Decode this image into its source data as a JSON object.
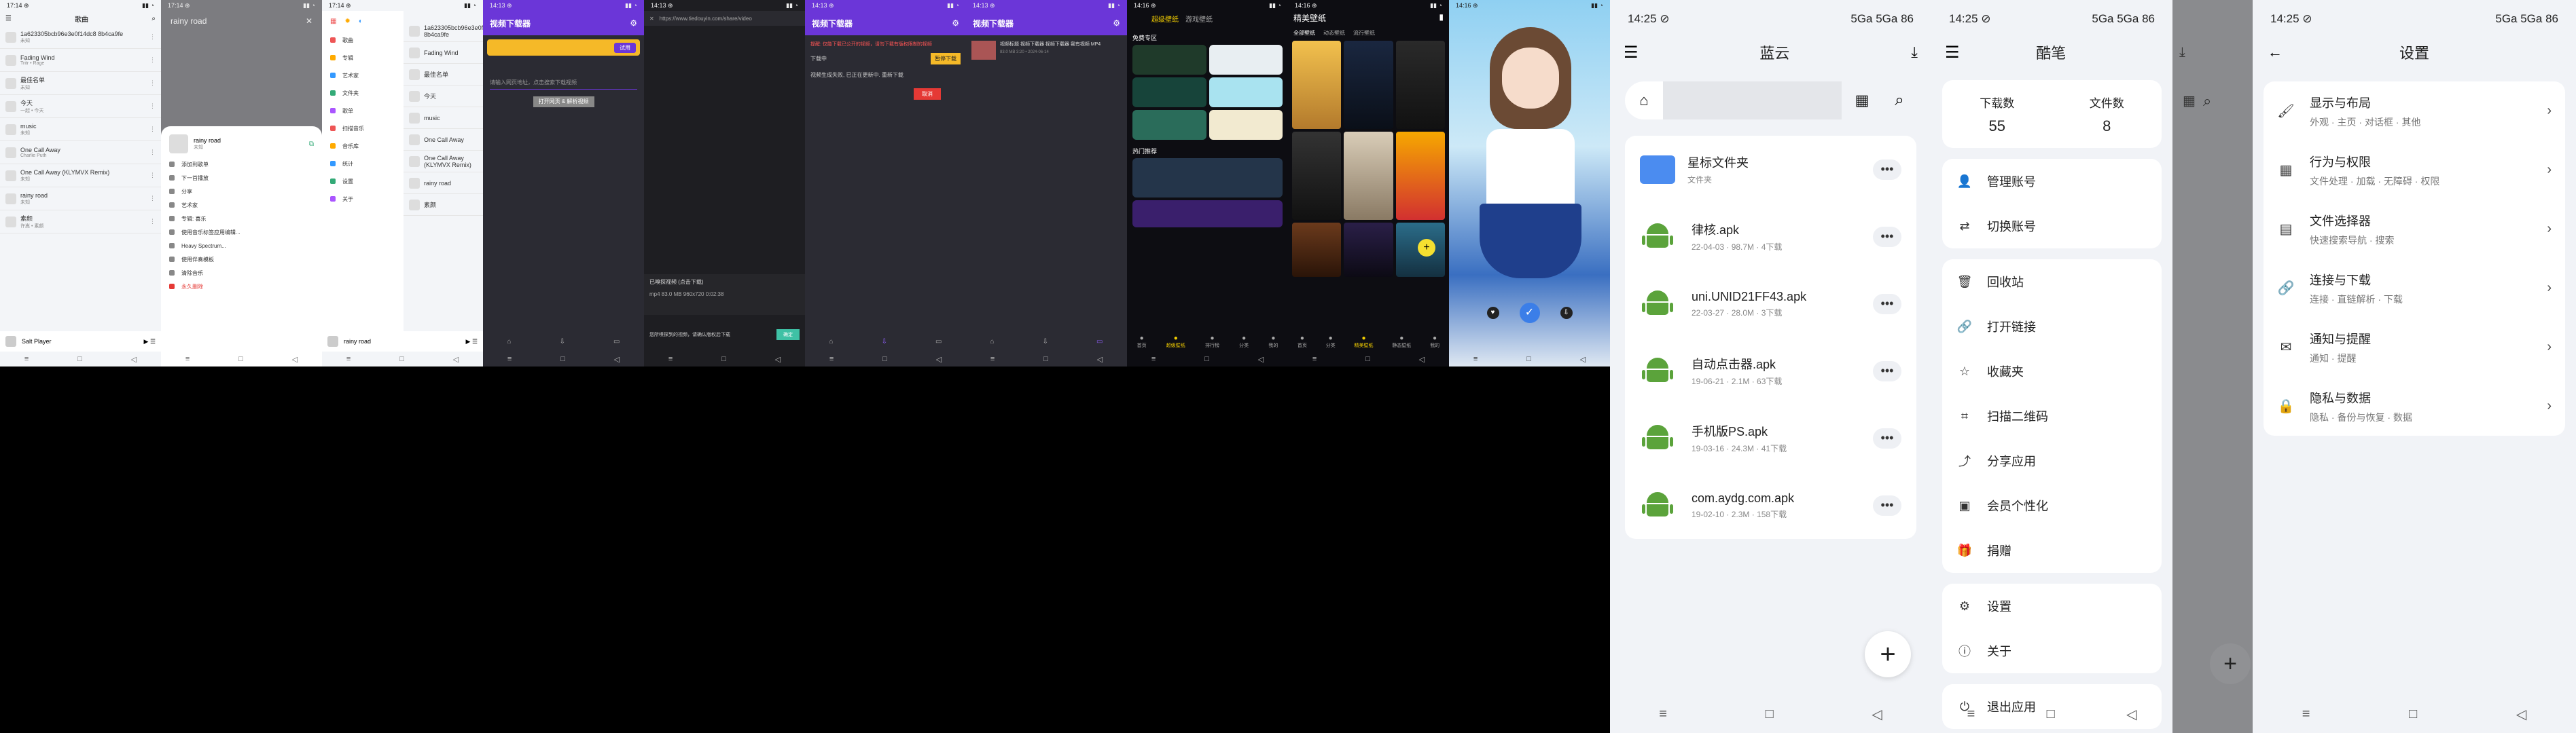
{
  "s1": {
    "time": "17:14 ⊕",
    "title": "歌曲",
    "rows": [
      {
        "name": "1a623305bcb96e3e0f14dc8 8b4ca9fe",
        "sub": "未知"
      },
      {
        "name": "Fading Wind",
        "sub": "Tritr • Rage"
      },
      {
        "name": "最佳名单",
        "sub": "未知"
      },
      {
        "name": "今天",
        "sub": "一起 • 今天"
      },
      {
        "name": "music",
        "sub": "未知"
      },
      {
        "name": "One Call Away",
        "sub": "Charlie Puth"
      },
      {
        "name": "One Call Away (KLYMVX Remix)",
        "sub": "未知"
      },
      {
        "name": "rainy road",
        "sub": "未知"
      },
      {
        "name": "素颜",
        "sub": "许嵩 • 素颜"
      }
    ],
    "player": "Salt Player"
  },
  "s2": {
    "time": "17:14 ⊕",
    "title": "rainy road",
    "song": "rainy road",
    "song_sub": "未知",
    "menu": [
      "添加到歌单",
      "下一首播放",
      "分享",
      "艺术家",
      "专辑: 喜乐",
      "使用音乐标签应用编辑...",
      "Heavy Spectrum...",
      "使用伴奏模板",
      "清除音乐",
      "永久删除"
    ]
  },
  "s3": {
    "time": "17:14 ⊕",
    "menu": [
      "歌曲",
      "专辑",
      "艺术家",
      "文件夹",
      "歌单",
      "扫描音乐",
      "音乐库",
      "统计",
      "设置",
      "关于"
    ],
    "rows": [
      "1a623305bcb96e3e0f 8b4ca9fe",
      "Fading Wind",
      "最佳名单",
      "今天",
      "music",
      "One Call Away",
      "One Call Away (KLYMVX Remix)",
      "rainy road",
      "素颜"
    ],
    "player": "rainy road"
  },
  "s4": {
    "time": "14:13 ⊕",
    "title": "视频下载器",
    "banner": "试用",
    "input_placeholder": "请输入网页地址，点击搜索下载视频",
    "button": "打开网页 & 解析视频"
  },
  "s5": {
    "time": "14:13 ⊕",
    "url": "https://www.tiedouyin.com/share/video",
    "bottom_title": "已嗅探视频 (点击下载)",
    "bottom_item": "mp4 83.0 MB 960x720 0:02:38",
    "tip": "您所嗅探到的视频，请确认版权后下载",
    "tip_btn": "确定"
  },
  "s6": {
    "time": "14:13 ⊕",
    "title": "视频下载器",
    "desc": "提醒: 仅能下载已公开的视频，请勿下载有版权限制的视频",
    "status": "下载中",
    "btn": "暂停下载",
    "detail": "视频生成失败, 已正在更新中. 重新下载",
    "red_btn": "取消"
  },
  "s7": {
    "time": "14:13 ⊕",
    "title": "视频下载器",
    "item": "视频标题 视频下载器 视频下载器 我有视频 MP4",
    "meta": "83.0 MB 3:20 • 2024-06-14"
  },
  "s8": {
    "time": "14:16 ⊕",
    "tabs": [
      "超级壁纸",
      "游戏壁纸"
    ],
    "sec1": "免费专区",
    "sec2": "热门推荐",
    "nav": [
      "首页",
      "超级壁纸",
      "排行榜",
      "分类",
      "我的"
    ]
  },
  "s9": {
    "time": "14:16 ⊕",
    "title": "精美壁纸",
    "tabs": [
      "全部壁纸",
      "动态壁纸",
      "流行壁纸"
    ],
    "nav": [
      "首页",
      "分类",
      "精美壁纸",
      "静态壁纸",
      "我的"
    ]
  },
  "s10": {
    "time": "14:16 ⊕"
  },
  "lanzou": {
    "time": "14:25 ⊘",
    "signal": "5Ga 5Ga 86",
    "title": "蓝云",
    "star": {
      "name": "星标文件夹",
      "sub": "文件夹"
    },
    "files": [
      {
        "name": "律核.apk",
        "meta": "22-04-03 · 98.7M · 4下载"
      },
      {
        "name": "uni.UNID21FF43.apk",
        "meta": "22-03-27 · 28.0M · 3下载"
      },
      {
        "name": "自动点击器.apk",
        "meta": "19-06-21 · 2.1M · 63下载"
      },
      {
        "name": "手机版PS.apk",
        "meta": "19-03-16 · 24.3M · 41下载"
      },
      {
        "name": "com.aydg.com.apk",
        "meta": "19-02-10 · 2.3M · 158下载"
      }
    ]
  },
  "kuanbi": {
    "time": "14:25 ⊘",
    "signal": "5Ga 5Ga 86",
    "title": "酷笔",
    "stats": [
      {
        "label": "下载数",
        "value": "55"
      },
      {
        "label": "文件数",
        "value": "8"
      }
    ],
    "group1": [
      "管理账号",
      "切换账号"
    ],
    "group2": [
      "回收站",
      "打开链接",
      "收藏夹",
      "扫描二维码",
      "分享应用",
      "会员个性化",
      "捐赠"
    ],
    "group3": [
      "设置",
      "关于"
    ],
    "group4": [
      "退出应用"
    ]
  },
  "settings": {
    "time": "14:25 ⊘",
    "signal": "5Ga 5Ga 86",
    "title": "设置",
    "items": [
      {
        "title": "显示与布局",
        "sub": "外观 · 主页 · 对话框 · 其他"
      },
      {
        "title": "行为与权限",
        "sub": "文件处理 · 加载 · 无障碍 · 权限"
      },
      {
        "title": "文件选择器",
        "sub": "快速搜索导航 · 搜索"
      },
      {
        "title": "连接与下载",
        "sub": "连接 · 直链解析 · 下载"
      },
      {
        "title": "通知与提醒",
        "sub": "通知 · 提醒"
      },
      {
        "title": "隐私与数据",
        "sub": "隐私 · 备份与恢复 · 数据"
      }
    ]
  },
  "colors": {
    "purple": "#6b36d8",
    "android_green": "#5ba33b",
    "folder_blue": "#4b8cf0"
  }
}
